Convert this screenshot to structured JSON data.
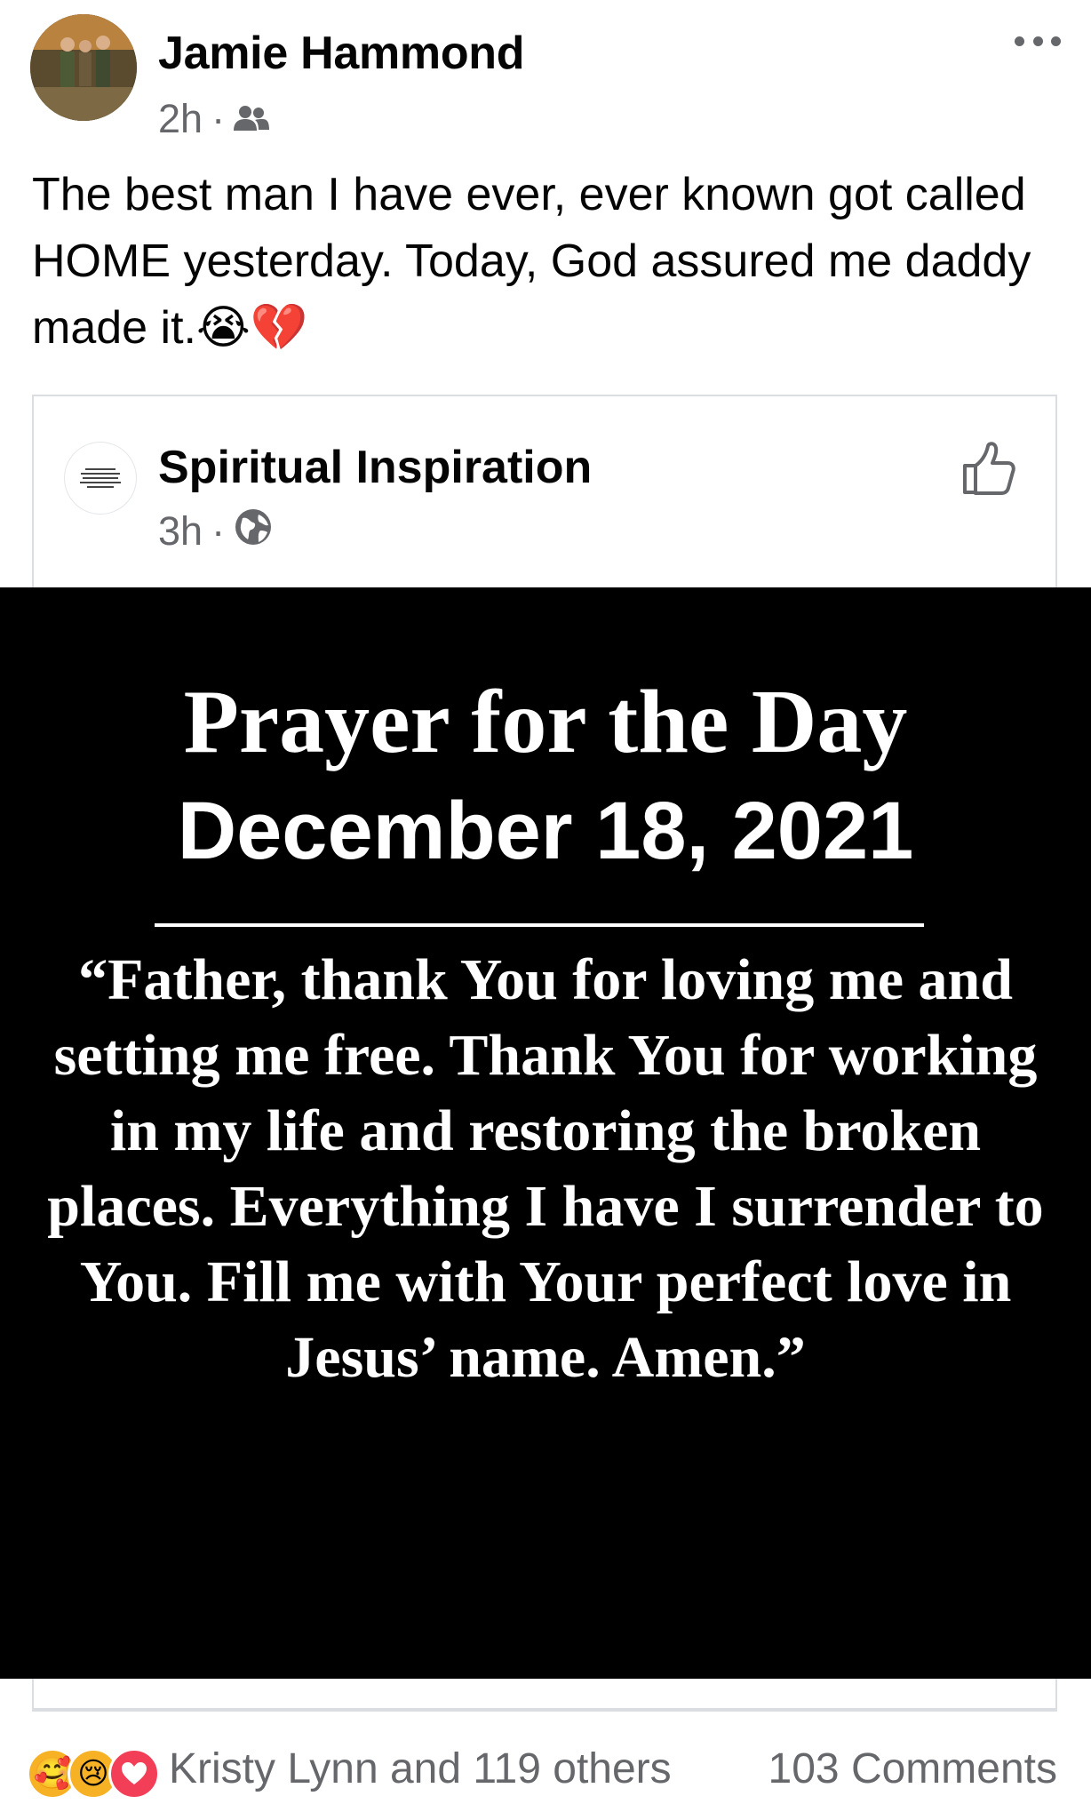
{
  "post": {
    "author": "Jamie Hammond",
    "time": "2h",
    "separator": "·",
    "audience_icon": "friends-icon",
    "text": "The best man I have ever, ever known got called HOME yesterday. Today, God assured me daddy made it.",
    "emojis": [
      "😭",
      "💔"
    ]
  },
  "shared": {
    "page_name": "Spiritual Inspiration",
    "time": "3h",
    "separator": "·",
    "audience_icon": "globe-icon",
    "image": {
      "title": "Prayer for the Day",
      "date": "December 18, 2021",
      "prayer": "“Father, thank You for loving me and setting me free. Thank You for working in my life and restoring the broken places. Everything I have I surrender to You. Fill me with Your perfect love in Jesus’ name. Amen.”"
    }
  },
  "footer": {
    "reactions": [
      "🥰",
      "😢",
      "❤"
    ],
    "reactor_summary": "Kristy Lynn and 119 others",
    "comments": "103 Comments"
  },
  "colors": {
    "text": "#050505",
    "secondary": "#65676b",
    "border": "#dadde1",
    "image_bg": "#000000",
    "love": "#f33e58",
    "care": "#f7b125"
  }
}
